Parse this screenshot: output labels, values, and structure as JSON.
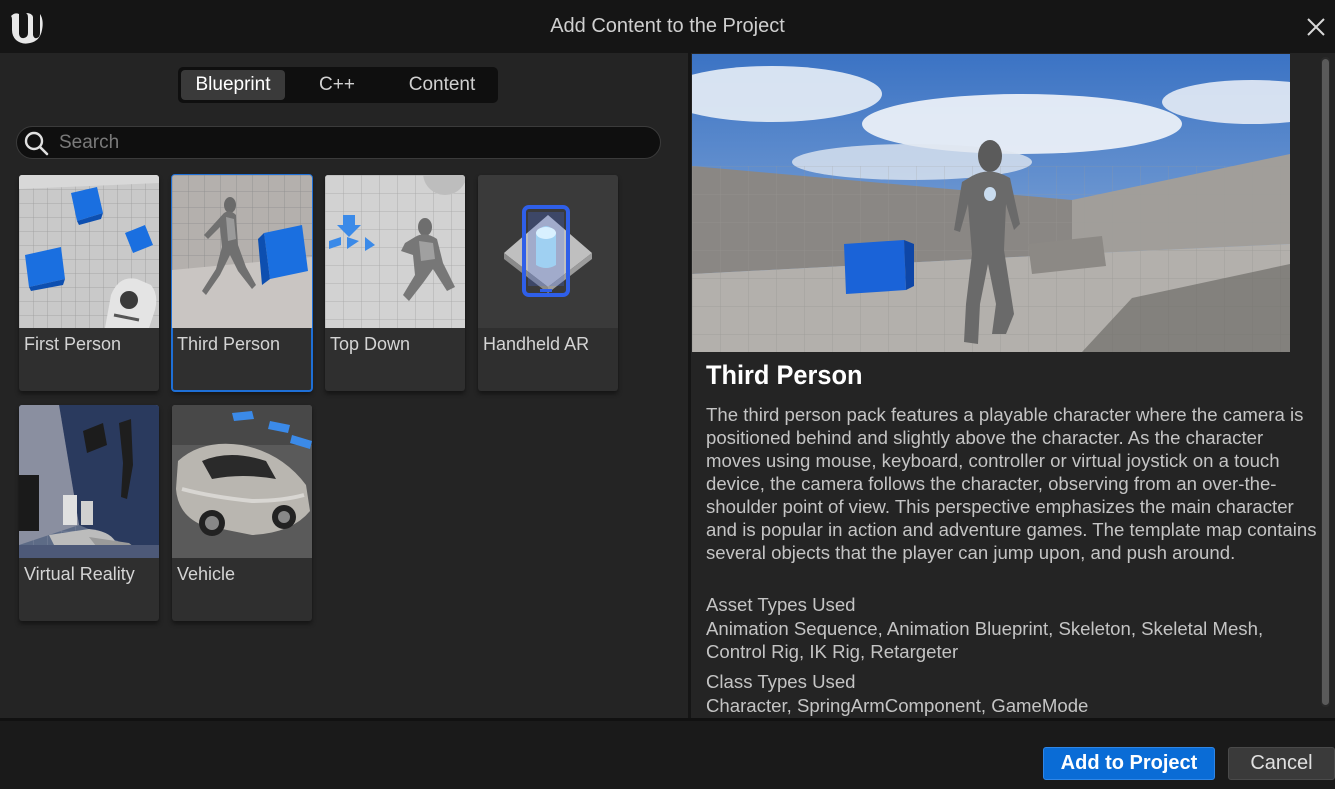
{
  "window": {
    "title": "Add Content to the Project",
    "logo_icon": "unreal-logo-icon",
    "close_icon": "close-icon"
  },
  "tabs": [
    {
      "label": "Blueprint",
      "active": true
    },
    {
      "label": "C++",
      "active": false
    },
    {
      "label": "Content",
      "active": false
    }
  ],
  "search": {
    "placeholder": "Search",
    "value": "",
    "icon": "search-icon"
  },
  "templates": [
    {
      "label": "First Person",
      "selected": false
    },
    {
      "label": "Third Person",
      "selected": true
    },
    {
      "label": "Top Down",
      "selected": false
    },
    {
      "label": "Handheld AR",
      "selected": false
    },
    {
      "label": "Virtual Reality",
      "selected": false
    },
    {
      "label": "Vehicle",
      "selected": false
    }
  ],
  "detail": {
    "title": "Third Person",
    "description": "The third person pack features a playable character where the camera is positioned behind and slightly above the character. As the character moves using mouse, keyboard, controller or virtual joystick on a touch device, the camera follows the character, observing from an over-the-shoulder point of view. This perspective emphasizes the main character and is popular in action and adventure games. The template map contains several objects that the player can jump upon, and push around.",
    "asset_types_heading": "Asset Types Used",
    "asset_types": "Animation Sequence, Animation Blueprint, Skeleton, Skeletal Mesh, Control Rig, IK Rig, Retargeter",
    "class_types_heading": "Class Types Used",
    "class_types": "Character, SpringArmComponent, GameMode"
  },
  "footer": {
    "add_label": "Add to Project",
    "cancel_label": "Cancel"
  },
  "colors": {
    "accent": "#0a6cd6",
    "selection": "#1e6fd6",
    "background": "#242424"
  }
}
